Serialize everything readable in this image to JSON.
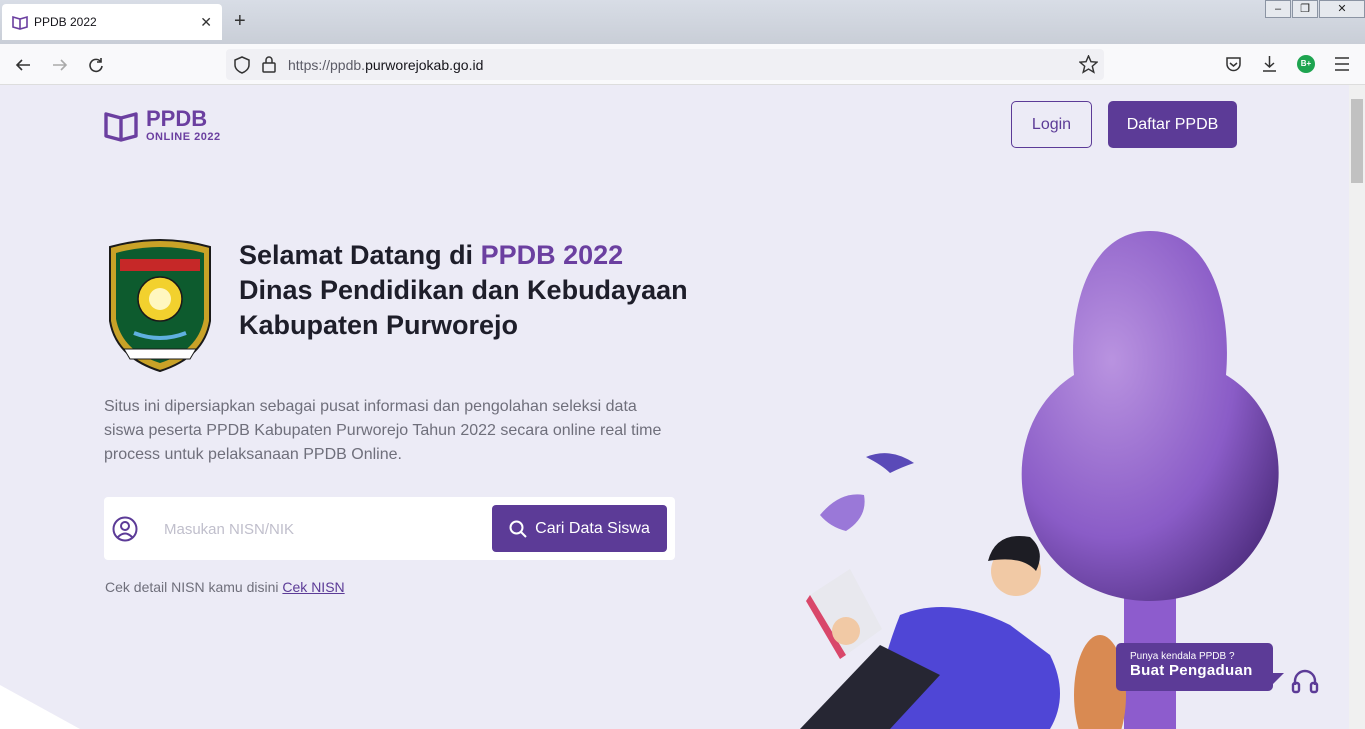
{
  "browser": {
    "tab_title": "PPDB 2022",
    "tab_close": "✕",
    "new_tab": "+",
    "url_prefix": "https://ppdb.",
    "url_domain": "purworejokab.go.id",
    "profile_badge": "B+"
  },
  "header": {
    "logo_title": "PPDB",
    "logo_subtitle": "ONLINE 2022",
    "login_label": "Login",
    "register_label": "Daftar PPDB"
  },
  "hero": {
    "title_prefix": "Selamat Datang di ",
    "title_highlight": "PPDB 2022",
    "title_rest": "Dinas Pendidikan dan Kebudayaan Kabupaten Purworejo",
    "description": "Situs ini dipersiapkan sebagai pusat informasi dan pengolahan seleksi data siswa peserta PPDB Kabupaten Purworejo Tahun 2022 secara online real time process untuk pelaksanaan PPDB Online."
  },
  "search": {
    "placeholder": "Masukan NISN/NIK",
    "button_label": "Cari Data Siswa",
    "hint_text": "Cek detail NISN kamu disini ",
    "hint_link": "Cek NISN"
  },
  "complaint": {
    "question": "Punya kendala PPDB ?",
    "action": "Buat Pengaduan"
  },
  "colors": {
    "accent": "#5c3b97",
    "page_bg": "#ecebf6"
  }
}
